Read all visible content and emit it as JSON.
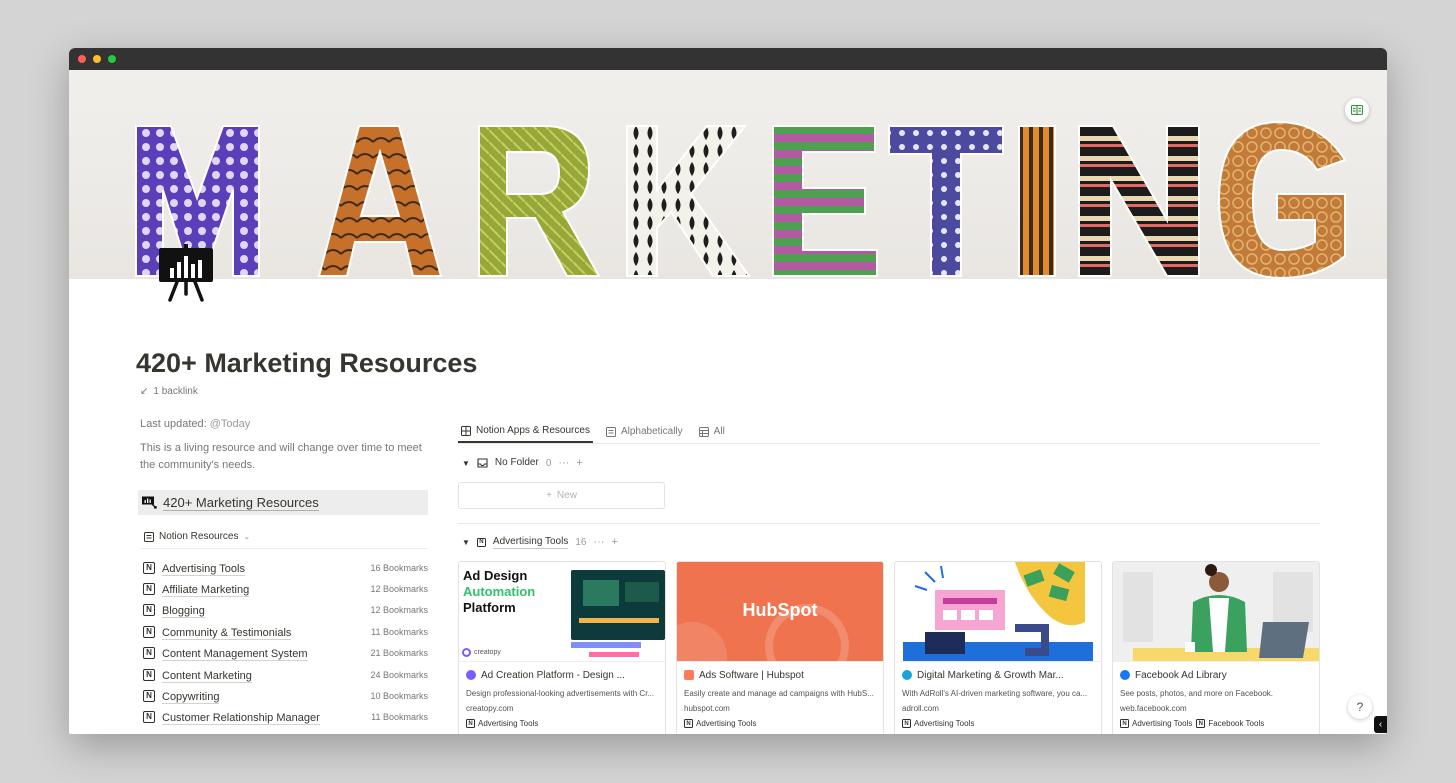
{
  "window": {
    "controls": [
      "close",
      "minimize",
      "maximize"
    ]
  },
  "cover": {
    "icon": "open-book-icon"
  },
  "page": {
    "icon": "presentation-chart-icon",
    "title": "420+ Marketing Resources",
    "backlinks": "1 backlink"
  },
  "meta": {
    "updated_label": "Last updated:",
    "updated_value": "@Today",
    "description": "This is a living resource and will change over time to meet the community's needs."
  },
  "resources": {
    "header": "420+ Marketing Resources",
    "view_label": "Notion Resources",
    "items": [
      {
        "name": "Advertising Tools",
        "count": "16 Bookmarks"
      },
      {
        "name": "Affiliate Marketing",
        "count": "12 Bookmarks"
      },
      {
        "name": "Blogging",
        "count": "12 Bookmarks"
      },
      {
        "name": "Community & Testimonials",
        "count": "11 Bookmarks"
      },
      {
        "name": "Content Management System",
        "count": "21 Bookmarks"
      },
      {
        "name": "Content Marketing",
        "count": "24 Bookmarks"
      },
      {
        "name": "Copywriting",
        "count": "10 Bookmarks"
      },
      {
        "name": "Customer Relationship Manager",
        "count": "11 Bookmarks"
      }
    ]
  },
  "database": {
    "tabs": [
      {
        "label": "Notion Apps & Resources",
        "icon": "board-icon",
        "active": true
      },
      {
        "label": "Alphabetically",
        "icon": "list-icon",
        "active": false
      },
      {
        "label": "All",
        "icon": "table-icon",
        "active": false
      }
    ],
    "groups": [
      {
        "name": "No Folder",
        "count": "0"
      },
      {
        "name": "Advertising Tools",
        "count": "16"
      }
    ],
    "new_label": "New",
    "cards": [
      {
        "image_headline": [
          "Ad Design",
          "Automation",
          "Platform"
        ],
        "image_brand": "creatopy",
        "title": "Ad Creation Platform - Design ...",
        "desc": "Design professional-looking advertisements with Cr...",
        "url": "creatopy.com",
        "tags": [
          "Advertising Tools"
        ],
        "favicon_color": "#7a5cff"
      },
      {
        "image_brand": "HubSpot",
        "title": "Ads Software | Hubspot",
        "desc": "Easily create and manage ad campaigns with HubS...",
        "url": "hubspot.com",
        "tags": [
          "Advertising Tools"
        ],
        "favicon_color": "#ff7a59"
      },
      {
        "title": "Digital Marketing & Growth Mar...",
        "desc": "With AdRoll's AI-driven marketing software, you ca...",
        "url": "adroll.com",
        "tags": [
          "Advertising Tools"
        ],
        "favicon_color": "#1aa3d9"
      },
      {
        "title": "Facebook Ad Library",
        "desc": "See posts, photos, and more on Facebook.",
        "url": "web.facebook.com",
        "tags": [
          "Advertising Tools",
          "Facebook Tools"
        ],
        "favicon_color": "#1877f2"
      }
    ]
  },
  "help": {
    "label": "?"
  }
}
